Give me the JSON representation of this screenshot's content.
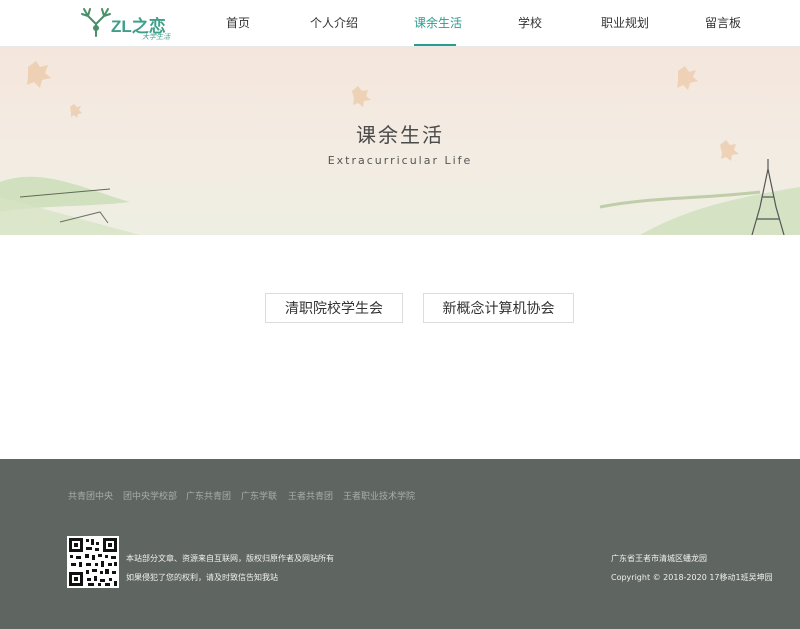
{
  "header": {
    "logo_text": "ZL之恋",
    "logo_sub": "大学生活",
    "nav": [
      {
        "label": "首页",
        "active": false
      },
      {
        "label": "个人介绍",
        "active": false
      },
      {
        "label": "课余生活",
        "active": true
      },
      {
        "label": "学校",
        "active": false
      },
      {
        "label": "职业规划",
        "active": false
      },
      {
        "label": "留言板",
        "active": false
      }
    ]
  },
  "banner": {
    "title": "课余生活",
    "subtitle": "Extracurricular Life"
  },
  "categories": [
    "清职院校学生会",
    "新概念计算机协会"
  ],
  "footer": {
    "links": [
      "共青团中央",
      "团中央学校部",
      "广东共青团",
      "广东学联",
      "王者共青团",
      "王者职业技术学院"
    ],
    "notice_line1": "本站部分文章、资源来自互联网，版权归原作者及网站所有",
    "notice_line2": "如果侵犯了您的权利，请及时致信告知我站",
    "address": "广东省王者市清城区蟠龙园",
    "copyright": "Copyright © 2018-2020 17移动1班吴坤园"
  },
  "colors": {
    "accent": "#2a9d8f",
    "footer_bg": "#5f6560"
  }
}
